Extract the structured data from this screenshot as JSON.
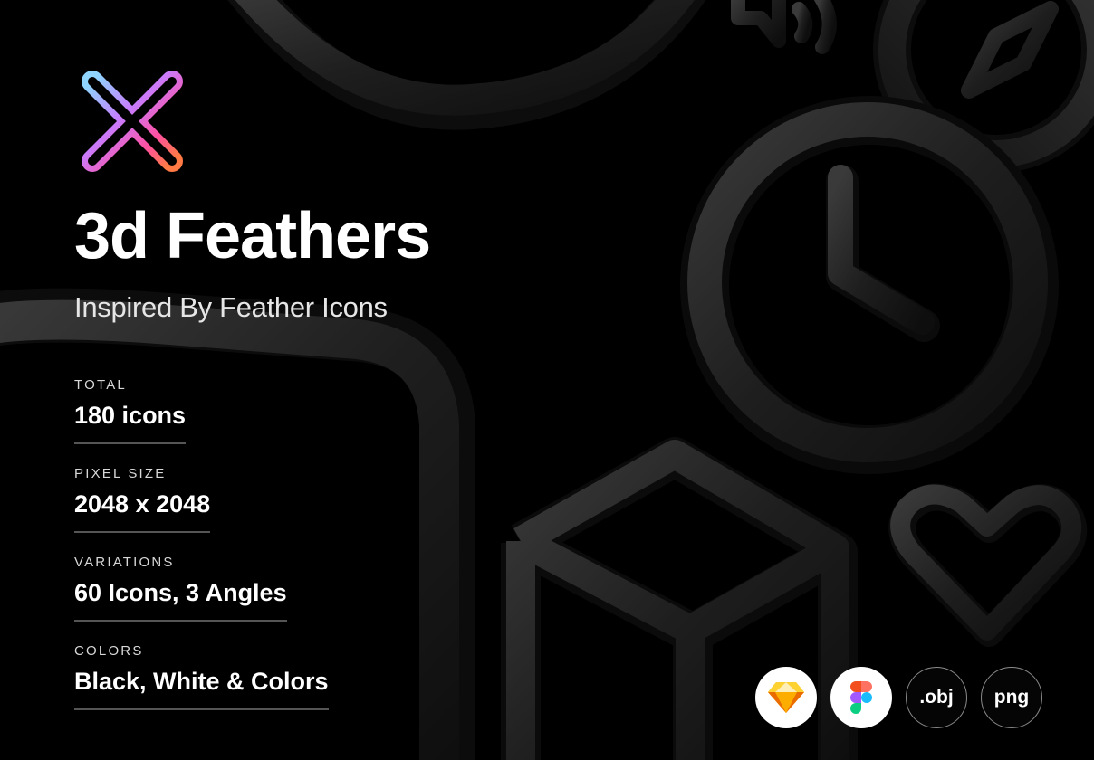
{
  "hero": {
    "title": "3d Feathers",
    "subtitle": "Inspired By Feather Icons"
  },
  "specs": [
    {
      "label": "TOTAL",
      "value": "180 icons"
    },
    {
      "label": "PIXEL SIZE",
      "value": "2048 x 2048"
    },
    {
      "label": "VARIATIONS",
      "value": "60 Icons, 3 Angles"
    },
    {
      "label": "COLORS",
      "value": "Black, White & Colors"
    }
  ],
  "formats": {
    "sketch_icon": "sketch-icon",
    "figma_icon": "figma-icon",
    "obj_label": ".obj",
    "png_label": "png"
  },
  "colors": {
    "background": "#000000",
    "icon_surface": "#1c1c1c",
    "logo_gradient": [
      "#8fd3ff",
      "#c77dff",
      "#ff4fa0",
      "#ff7a45"
    ]
  }
}
